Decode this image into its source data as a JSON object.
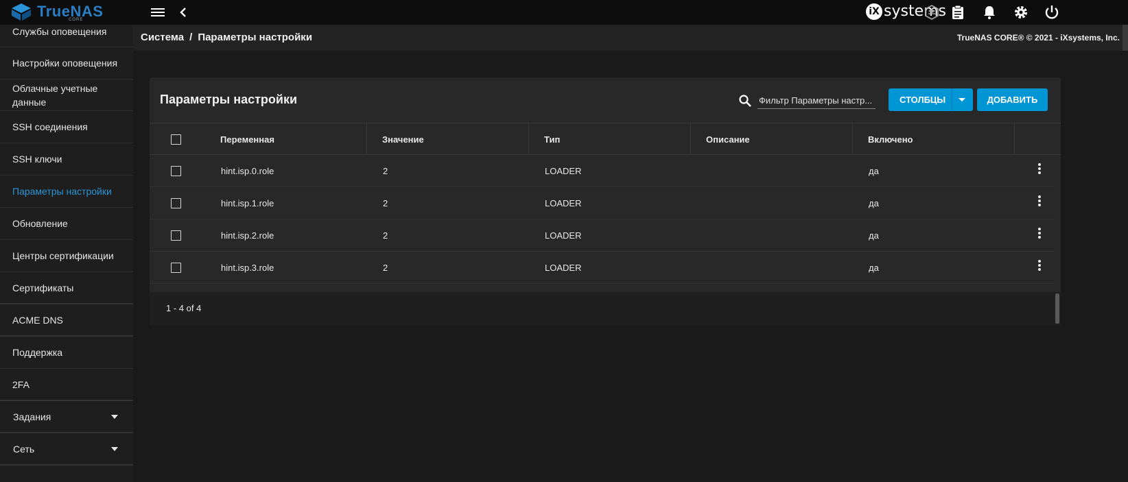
{
  "topbar": {
    "brand": "TrueNAS",
    "brand_sub": "CORE",
    "ix_logo_mark": "iX",
    "ix_logo_text": "systems",
    "icons": [
      "menu-icon",
      "chevron-left-icon",
      "truecommand-icon",
      "clipboard-icon",
      "bell-icon",
      "gear-icon",
      "power-icon"
    ]
  },
  "sidebar": {
    "items": [
      {
        "label": "Службы оповещения"
      },
      {
        "label": "Настройки оповещения"
      },
      {
        "label": "Облачные учетные данные"
      },
      {
        "label": "SSH соединения"
      },
      {
        "label": "SSH ключи"
      },
      {
        "label": "Параметры настройки",
        "active": true
      },
      {
        "label": "Обновление"
      },
      {
        "label": "Центры сертификации"
      },
      {
        "label": "Сертификаты"
      },
      {
        "label": "ACME DNS"
      },
      {
        "label": "Поддержка"
      },
      {
        "label": "2FA"
      }
    ],
    "groups": [
      {
        "label": "Задания"
      },
      {
        "label": "Сеть"
      }
    ]
  },
  "breadcrumb": {
    "parent": "Система",
    "separator": "/",
    "current": "Параметры настройки"
  },
  "copyright": "TrueNAS CORE® © 2021 - iXsystems, Inc.",
  "card": {
    "title": "Параметры настройки",
    "filter_placeholder": "Фильтр Параметры настр...",
    "columns_button": "СТОЛБЦЫ",
    "add_button": "ДОБАВИТЬ"
  },
  "table": {
    "headers": [
      "Переменная",
      "Значение",
      "Тип",
      "Описание",
      "Включено"
    ],
    "rows": [
      {
        "variable": "hint.isp.0.role",
        "value": "2",
        "type": "LOADER",
        "description": "",
        "enabled": "да"
      },
      {
        "variable": "hint.isp.1.role",
        "value": "2",
        "type": "LOADER",
        "description": "",
        "enabled": "да"
      },
      {
        "variable": "hint.isp.2.role",
        "value": "2",
        "type": "LOADER",
        "description": "",
        "enabled": "да"
      },
      {
        "variable": "hint.isp.3.role",
        "value": "2",
        "type": "LOADER",
        "description": "",
        "enabled": "да"
      }
    ],
    "pagination": "1 - 4 of 4"
  },
  "colors": {
    "accent": "#0095d5",
    "active_nav": "#2a94d6",
    "brand": "#2a7ec3"
  }
}
